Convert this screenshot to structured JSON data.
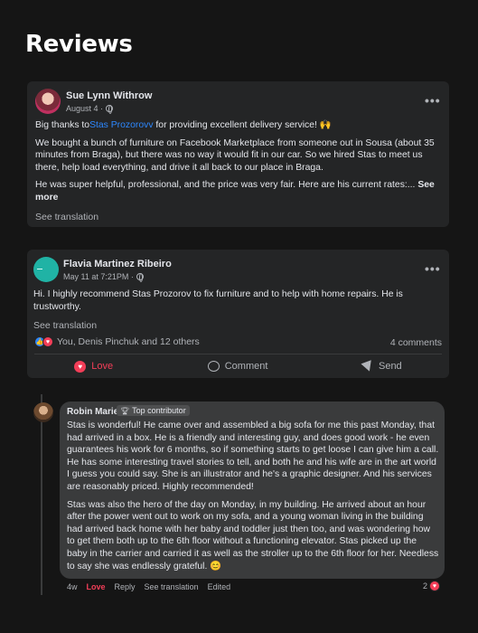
{
  "page": {
    "title": "Reviews"
  },
  "reviews": [
    {
      "author": "Sue Lynn Withrow",
      "date": "August 4 ·",
      "more": "•••",
      "line1_pre": "Big thanks to",
      "line1_link": "Stas Prozorovv",
      "line1_post": " for providing excellent delivery service! 🙌",
      "paragraph2": "We bought a bunch of furniture on Facebook Marketplace from someone out in Sousa (about 35 minutes from Braga), but there was no way it would fit in our car. So we hired Stas to meet us there, help load everything, and drive it all back to our place in Braga.",
      "paragraph3": "He was super helpful, professional, and the price was very fair. Here are his current rates:...",
      "see_more": "See more",
      "see_translation": "See translation"
    },
    {
      "author": "Flavia Martinez Ribeiro",
      "date": "May 11 at 7:21PM ·",
      "more": "•••",
      "text": "Hi. I highly recommend Stas Prozorov to fix furniture and to help with home repairs. He is trustworthy.",
      "see_translation": "See translation",
      "reaction_names": "You, Denis Pinchuk and 12 others",
      "comments": "4 comments",
      "actions": {
        "love": "Love",
        "comment": "Comment",
        "send": "Send"
      }
    }
  ],
  "comment": {
    "author": "Robin Marie",
    "badge": "Top contributor",
    "paragraph1": "Stas is wonderful! He came over and assembled a big sofa for me this past Monday, that had arrived in a box. He is a friendly and interesting guy, and does good work - he even guarantees his work for 6 months, so if something starts to get loose I can give him a call. He has some interesting travel stories to tell, and both he and his wife are in the art world I guess you could say. She is an illustrator and he's a graphic designer. And his services are reasonably priced. Highly recommended!",
    "paragraph2": "Stas was also the hero of the day on Monday, in my building. He arrived about an hour after the power went out to work on my sofa, and a young woman living in the building had arrived back home with her baby and toddler just then too, and was wondering how to get them both up to the 6th floor without a functioning elevator. Stas picked up the baby in the carrier and carried it as well as the stroller up to the 6th floor for her. Needless to say she was endlessly grateful. 😊",
    "footer": {
      "age": "4w",
      "love": "Love",
      "reply": "Reply",
      "translate": "See translation",
      "edited": "Edited"
    },
    "reaction_count": "2"
  },
  "icons": {
    "globe": "globe-icon",
    "more": "more-options-icon",
    "like": "like-icon",
    "love": "heart-icon",
    "comment": "comment-icon",
    "send": "send-icon",
    "badge": "top-contributor-badge-icon"
  },
  "colors": {
    "background": "#151515",
    "card": "#242526",
    "link": "#2d88ff",
    "love": "#f33e58",
    "muted": "#b0b3b8"
  }
}
